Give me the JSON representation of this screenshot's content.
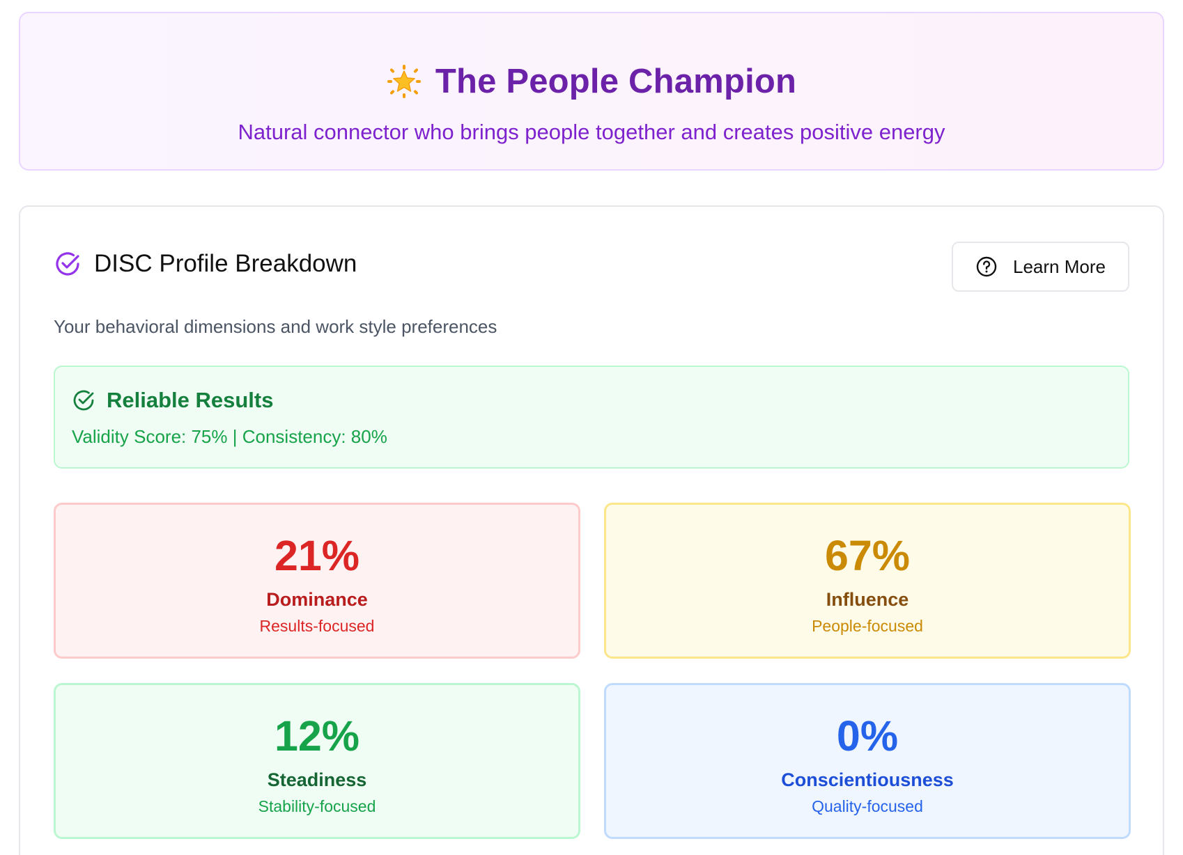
{
  "hero": {
    "emoji_icon": "glowing-star-icon",
    "title": "The People Champion",
    "subtitle": "Natural connector who brings people together and creates positive energy"
  },
  "profile": {
    "title_icon": "circle-check-icon",
    "title": "DISC Profile Breakdown",
    "learn_more_icon": "question-circle-icon",
    "learn_more_label": "Learn More",
    "description": "Your behavioral dimensions and work style preferences"
  },
  "reliability": {
    "icon": "circle-check-icon",
    "title": "Reliable Results",
    "metrics": "Validity Score: 75% | Consistency: 80%"
  },
  "disc": [
    {
      "percent": "21%",
      "name": "Dominance",
      "focus": "Results-focused",
      "color": "#dc2626"
    },
    {
      "percent": "67%",
      "name": "Influence",
      "focus": "People-focused",
      "color": "#ca8a04"
    },
    {
      "percent": "12%",
      "name": "Steadiness",
      "focus": "Stability-focused",
      "color": "#16a34a"
    },
    {
      "percent": "0%",
      "name": "Conscientiousness",
      "focus": "Quality-focused",
      "color": "#2563eb"
    }
  ],
  "colors": {
    "accent_purple": "#7e22ce",
    "success_green": "#16a34a"
  }
}
